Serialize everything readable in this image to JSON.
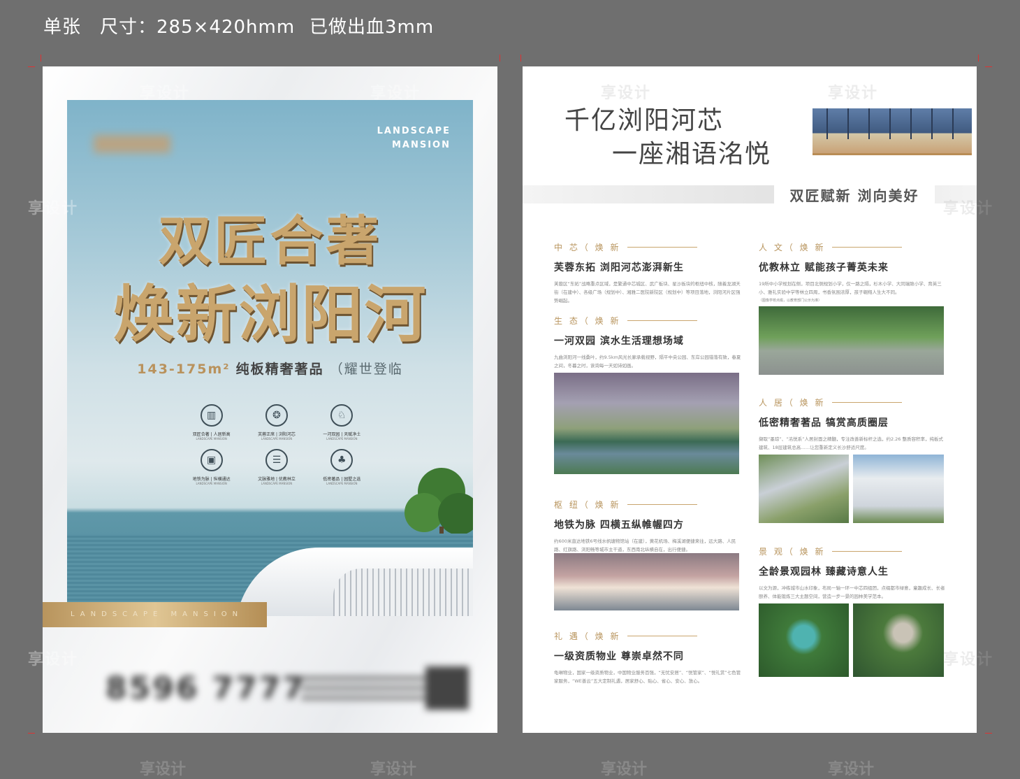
{
  "header": {
    "label1": "单张",
    "label2": "尺寸：285×420hmm",
    "label3": "已做出血3mm"
  },
  "front": {
    "brand_line1": "LANDSCAPE",
    "brand_line2": "MANSION",
    "title_line1": "双匠合著",
    "title_line2": "焕新浏阳河",
    "subtitle_area": "143-175m²",
    "subtitle_name": "纯板精奢著品",
    "subtitle_tag": "（耀世登临",
    "icons": [
      {
        "icon": "building-icon",
        "glyph": "▥",
        "label": "双匠合著 | 人居新高"
      },
      {
        "icon": "swirl-icon",
        "glyph": "❂",
        "label": "芙蓉正席 | 浏阳河芯"
      },
      {
        "icon": "deer-icon",
        "glyph": "♘",
        "label": "一河双园 | 天赋净土"
      },
      {
        "icon": "train-icon",
        "glyph": "▣",
        "label": "地铁为脉 | 纵横通达"
      },
      {
        "icon": "book-icon",
        "glyph": "☰",
        "label": "文脉雅地 | 优教林立"
      },
      {
        "icon": "tree-icon",
        "glyph": "♣",
        "label": "低密著品 | 园墅之选"
      }
    ],
    "icon_sublabel": "LANDSCAPE MANSION",
    "goldbar": "LANDSCAPE MANSION",
    "phone": "8596 7777"
  },
  "back": {
    "title_line1": "千亿浏阳河芯",
    "title_line2": "一座湘语洺悦",
    "band_label": "双匠赋新 浏向美好",
    "sections": [
      {
        "head": "中 芯（ 焕 新",
        "title": "芙蓉东拓 浏阳河芯澎湃新生",
        "body": "芙蓉区“东拓”战略重点区域，是繁通中芯城区、武广板块、星沙板块的枢纽中核，随着龙湖天街（在建中）、各级广场（规划中）、湘雅二医院新院区（规划中）等项目落地，浏阳河片区强势崛起。"
      },
      {
        "head": "生 态（ 焕 新",
        "title": "一河双园 滨水生活理想场域",
        "body": "九曲浏阳河一线桑叶，约9.5km风光长廊承载视野，隔平中央公园、东岸公园错落有致，春夏之间，冬暮之时，诶询每一天如诗如画。"
      },
      {
        "head": "枢 纽（ 焕 新",
        "title": "地铁为脉 四横五纵帷幄四方",
        "body": "约600米直达地铁6号线水帆塘物馆站（在建），黄花机场、梅溪湖便捷来往，远大路、人民路、红旗路、浏阳畅等城市主干道，东西南北纵横自在，出行便捷。"
      },
      {
        "head": "礼 遇（ 焕 新",
        "title": "一级资质物业 尊崇卓然不同",
        "body": "龟琳物业，国家一级资质物业，中国物业服务百强，“无忧安居”、“悦管家”、“悦礼赏”七色管家服务，“WE善云”五大定制礼遇，居家舒心、贴心、省心、安心、放心。"
      },
      {
        "head": "人 文（ 焕 新",
        "title": "优教林立 赋能孩子菁英未来",
        "body": "19所中小学规划在侧，项目北侧规划小学，仅一路之隔，杉木小学、大同瑞致小学、育英三小、雅礼实验中学等林立四周，书香氛围浓厚，孩子翱翔人生大不同。"
      },
      {
        "head": "人 居（ 焕 新",
        "title": "低密精奢著品 犒赏高质圈层",
        "body": "撷取“墨琼”、“洺悦系”人居封面之精髓，专注改善新标杆之选，约2.26 整质容积率，纯板式建筑、18层建筑总高……让您重新定义长沙舒适尺度。"
      },
      {
        "head": "景 观（ 焕 新",
        "title": "全龄景观园林 臻藏诗意人生",
        "body": "以文为源，冲练城市山水印象，布局一轴一环一中芯四组团，点缀都市绿意，童趣成长、长者颐养、体能锻炼三大主题空间，营造一步一景的园林美学范本。"
      }
    ],
    "school_note": "（图像学校点缀，以教育部门公示为准）"
  },
  "watermark": "享设计"
}
